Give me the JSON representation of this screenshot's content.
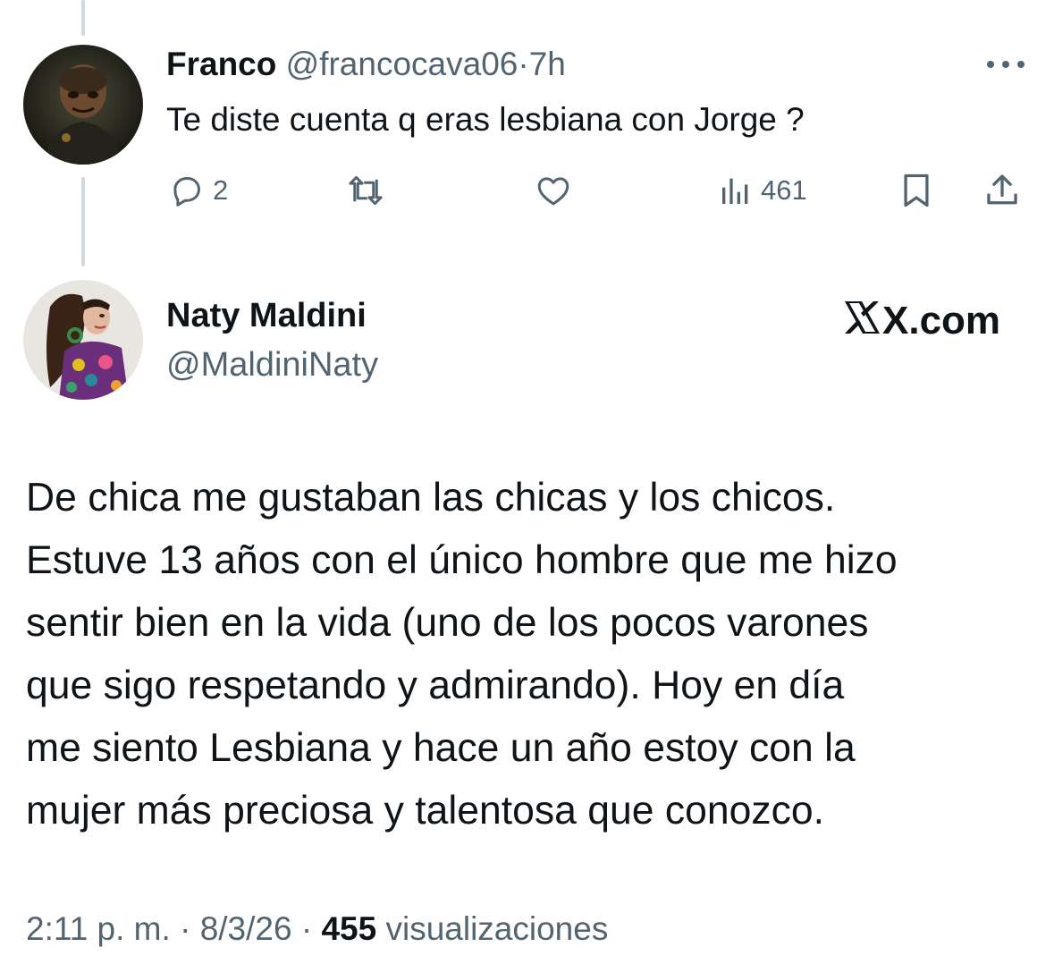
{
  "reply": {
    "author_name": "Franco",
    "handle": "@francocava06",
    "separator": "·",
    "time": "7h",
    "text": "Te diste cuenta q eras lesbiana con Jorge ?",
    "avatar_icon": "franco-avatar-photo",
    "more_icon": "more-dots-icon",
    "actions": {
      "reply_icon": "reply-bubble-icon",
      "reply_count": "2",
      "retweet_icon": "retweet-icon",
      "like_icon": "heart-icon",
      "views_icon": "bar-chart-icon",
      "views_count": "461",
      "bookmark_icon": "bookmark-icon",
      "share_icon": "share-upload-icon"
    }
  },
  "tweet": {
    "author_name": "Naty Maldini",
    "handle": "@MaldiniNaty",
    "avatar_icon": "naty-avatar-photo",
    "watermark": "X.com",
    "lines": [
      "De chica me gustaban las chicas y los chicos.",
      "Estuve 13 años con el único hombre que me hizo",
      "sentir bien en la vida (uno de los pocos varones",
      "que sigo respetando y admirando). Hoy en día",
      "me siento Lesbiana y hace un año estoy con la",
      "mujer más preciosa y talentosa que conozco."
    ],
    "meta": {
      "time": "2:11 p. m.",
      "dot": "·",
      "date": "8/3/26",
      "views_count": "455",
      "views_label": "visualizaciones"
    }
  },
  "colors": {
    "text": "#0f1419",
    "muted": "#536471",
    "thread_line": "#cfd9de",
    "background": "#ffffff"
  }
}
